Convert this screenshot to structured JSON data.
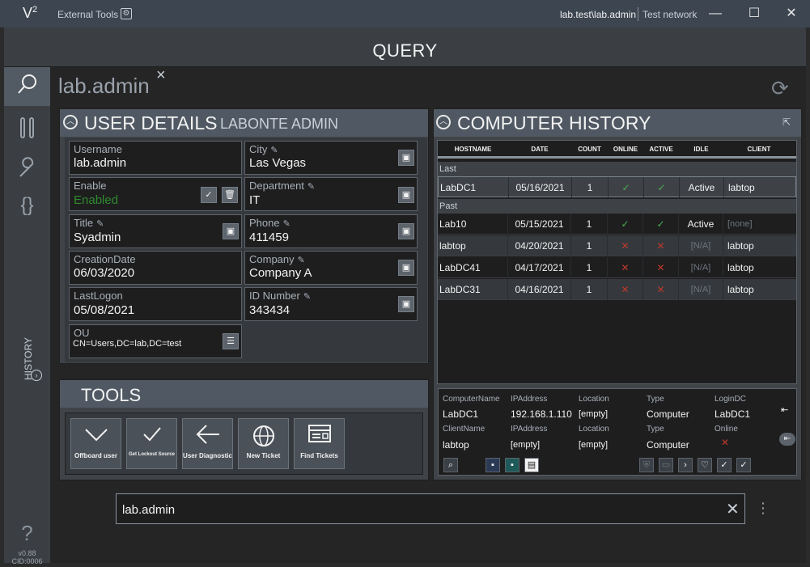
{
  "titlebar": {
    "logo": "V",
    "logo_sup": "2",
    "external_tools": "External Tools",
    "user_host": "lab.test\\lab.admin",
    "network": "Test network",
    "minimize": "—",
    "maximize": "☐",
    "close": "✕"
  },
  "header": {
    "title": "QUERY"
  },
  "sidebar": {
    "history_label": "HISTORY",
    "help": "?",
    "version": "v0.88",
    "cid": "CID:0006"
  },
  "main": {
    "username": "lab.admin",
    "close": "×"
  },
  "user_details": {
    "title": "USER DETAILS",
    "display_name": "LABONTE ADMIN",
    "fields": {
      "username": {
        "label": "Username",
        "value": "lab.admin"
      },
      "enable": {
        "label": "Enable",
        "value": "Enabled"
      },
      "title": {
        "label": "Title",
        "value": "Syadmin"
      },
      "creation_date": {
        "label": "CreationDate",
        "value": "06/03/2020"
      },
      "last_logon": {
        "label": "LastLogon",
        "value": "05/08/2021"
      },
      "ou": {
        "label": "OU",
        "value": "CN=Users,DC=lab,DC=test"
      },
      "city": {
        "label": "City",
        "value": "Las Vegas"
      },
      "department": {
        "label": "Department",
        "value": "IT"
      },
      "phone": {
        "label": "Phone",
        "value": "411459"
      },
      "company": {
        "label": "Company",
        "value": "Company A"
      },
      "id_number": {
        "label": "ID Number",
        "value": "343434"
      }
    }
  },
  "tools": {
    "title": "TOOLS",
    "items": [
      {
        "label": "Offboard user",
        "icon": "chevron-down-icon"
      },
      {
        "label": "Get Lockout Source",
        "icon": "check-icon"
      },
      {
        "label": "User Diagnostic",
        "icon": "arrow-left-icon"
      },
      {
        "label": "New Ticket",
        "icon": "globe-icon"
      },
      {
        "label": "Find Tickets",
        "icon": "ticket-list-icon"
      }
    ]
  },
  "computer_history": {
    "title": "COMPUTER HISTORY",
    "columns": [
      "HOSTNAME",
      "DATE",
      "COUNT",
      "ONLINE",
      "ACTIVE",
      "IDLE",
      "CLIENT"
    ],
    "groups": [
      "Last",
      "Past"
    ],
    "last_rows": [
      {
        "hostname": "LabDC1",
        "date": "05/16/2021",
        "count": "1",
        "online": "✓",
        "active": "✓",
        "idle": "Active",
        "client": "labtop"
      }
    ],
    "past_rows": [
      {
        "hostname": "Lab10",
        "date": "05/15/2021",
        "count": "1",
        "online": "✓",
        "active": "✓",
        "idle": "Active",
        "client": "[none]"
      },
      {
        "hostname": "labtop",
        "date": "04/20/2021",
        "count": "1",
        "online": "✕",
        "active": "✕",
        "idle": "[N/A]",
        "client": "labtop"
      },
      {
        "hostname": "LabDC41",
        "date": "04/17/2021",
        "count": "1",
        "online": "✕",
        "active": "✕",
        "idle": "[N/A]",
        "client": "labtop"
      },
      {
        "hostname": "LabDC31",
        "date": "04/16/2021",
        "count": "1",
        "online": "✕",
        "active": "✕",
        "idle": "[N/A]",
        "client": "labtop"
      }
    ]
  },
  "computer_info": {
    "labels": {
      "computer_name": "ComputerName",
      "ip_address": "IPAddress",
      "location": "Location",
      "type": "Type",
      "login_dc": "LoginDC",
      "client_name": "ClientName",
      "client_ip": "IPAddress",
      "client_location": "Location",
      "client_type": "Type",
      "online": "Online"
    },
    "values": {
      "computer_name": "LabDC1",
      "ip_address": "192.168.1.110",
      "location": "[empty]",
      "type": "Computer",
      "login_dc": "LabDC1",
      "client_name": "labtop",
      "client_ip": "[empty]",
      "client_location": "[empty]",
      "client_type": "Computer",
      "online": "✕"
    }
  },
  "search": {
    "value": "lab.admin",
    "clear": "✕",
    "more": "⋮"
  }
}
